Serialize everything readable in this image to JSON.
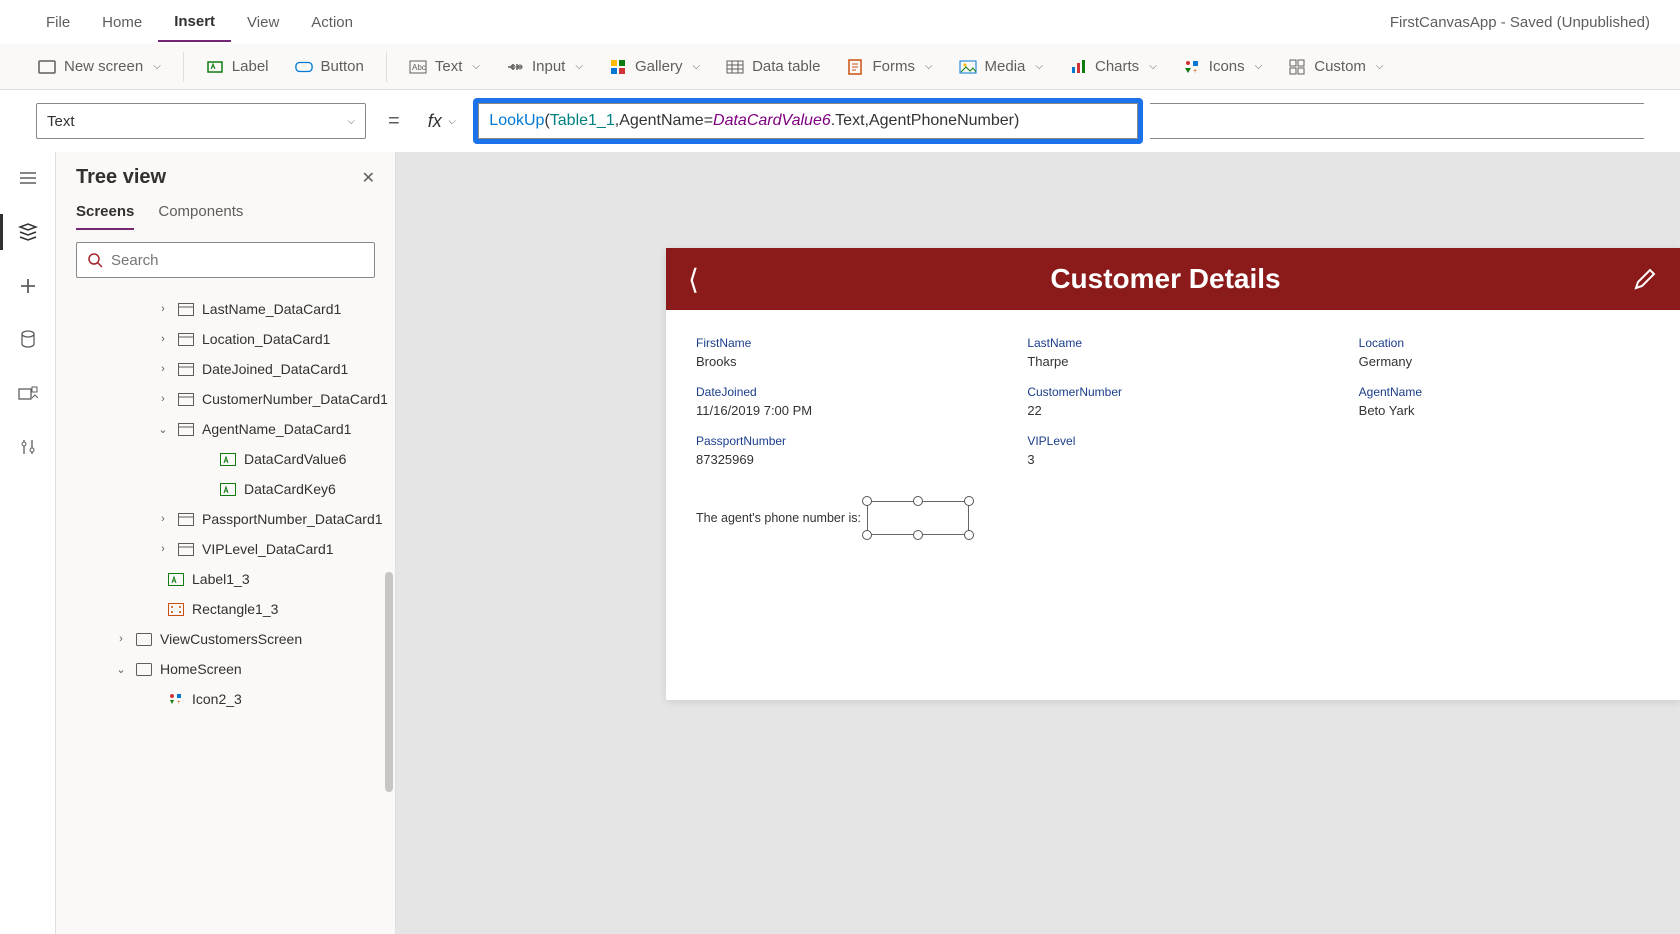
{
  "app_title": "FirstCanvasApp - Saved (Unpublished)",
  "menu": {
    "file": "File",
    "home": "Home",
    "insert": "Insert",
    "view": "View",
    "action": "Action"
  },
  "ribbon": {
    "new_screen": "New screen",
    "label": "Label",
    "button": "Button",
    "text": "Text",
    "input": "Input",
    "gallery": "Gallery",
    "data_table": "Data table",
    "forms": "Forms",
    "media": "Media",
    "charts": "Charts",
    "icons": "Icons",
    "custom": "Custom"
  },
  "property_selector": "Text",
  "formula": {
    "func": "LookUp",
    "open": "(",
    "source": "Table1_1",
    "sep1": ", ",
    "field1": "AgentName",
    "eq": " = ",
    "obj": "DataCardValue6",
    "prop": ".Text",
    "sep2": ", ",
    "field2": "AgentPhoneNumber",
    "close": ")"
  },
  "tree": {
    "title": "Tree view",
    "tabs": {
      "screens": "Screens",
      "components": "Components"
    },
    "search_placeholder": "Search",
    "items": [
      {
        "indent": 92,
        "exp": "›",
        "icon": "card",
        "label": "LastName_DataCard1"
      },
      {
        "indent": 92,
        "exp": "›",
        "icon": "card",
        "label": "Location_DataCard1"
      },
      {
        "indent": 92,
        "exp": "›",
        "icon": "card",
        "label": "DateJoined_DataCard1"
      },
      {
        "indent": 92,
        "exp": "›",
        "icon": "card",
        "label": "CustomerNumber_DataCard1"
      },
      {
        "indent": 92,
        "exp": "⌄",
        "icon": "card",
        "label": "AgentName_DataCard1"
      },
      {
        "indent": 134,
        "exp": "",
        "icon": "label",
        "label": "DataCardValue6"
      },
      {
        "indent": 134,
        "exp": "",
        "icon": "label",
        "label": "DataCardKey6"
      },
      {
        "indent": 92,
        "exp": "›",
        "icon": "card",
        "label": "PassportNumber_DataCard1"
      },
      {
        "indent": 92,
        "exp": "›",
        "icon": "card",
        "label": "VIPLevel_DataCard1"
      },
      {
        "indent": 82,
        "exp": "",
        "icon": "label",
        "label": "Label1_3"
      },
      {
        "indent": 82,
        "exp": "",
        "icon": "rect",
        "label": "Rectangle1_3"
      },
      {
        "indent": 50,
        "exp": "›",
        "icon": "screen",
        "label": "ViewCustomersScreen"
      },
      {
        "indent": 50,
        "exp": "⌄",
        "icon": "screen",
        "label": "HomeScreen"
      },
      {
        "indent": 82,
        "exp": "",
        "icon": "icons",
        "label": "Icon2_3"
      }
    ]
  },
  "preview": {
    "header": "Customer Details",
    "fields": {
      "firstname_l": "FirstName",
      "firstname_v": "Brooks",
      "lastname_l": "LastName",
      "lastname_v": "Tharpe",
      "location_l": "Location",
      "location_v": "Germany",
      "datejoined_l": "DateJoined",
      "datejoined_v": "11/16/2019 7:00 PM",
      "custnum_l": "CustomerNumber",
      "custnum_v": "22",
      "agent_l": "AgentName",
      "agent_v": "Beto Yark",
      "passport_l": "PassportNumber",
      "passport_v": "87325969",
      "vip_l": "VIPLevel",
      "vip_v": "3"
    },
    "agent_phone_label": "The agent's phone number is:"
  }
}
